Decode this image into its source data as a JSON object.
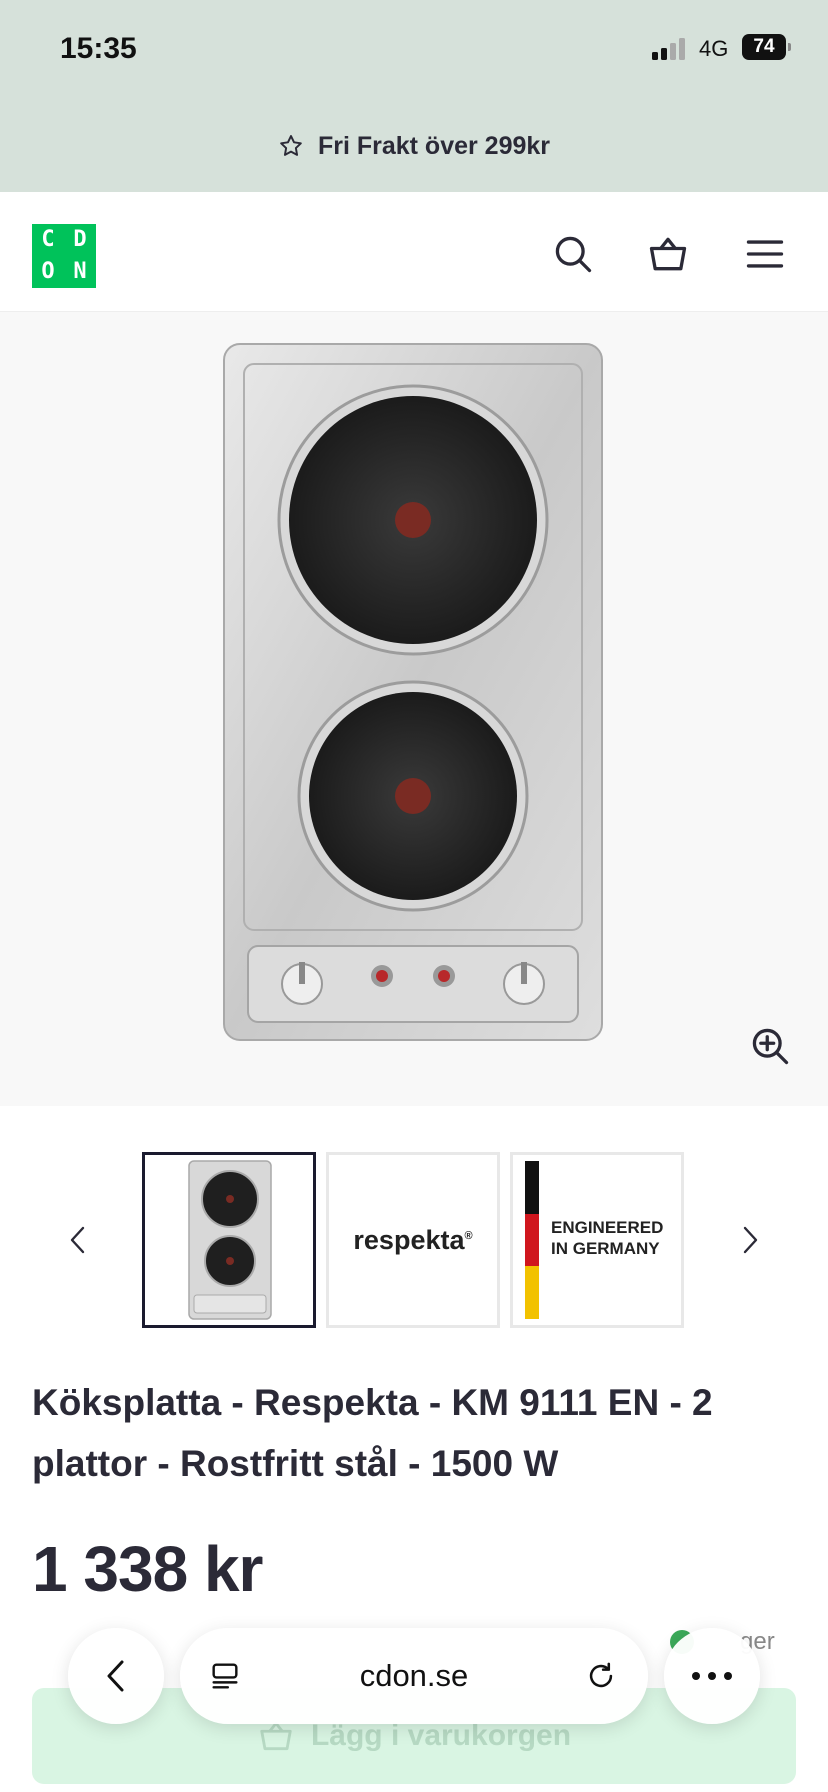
{
  "status": {
    "time": "15:35",
    "network": "4G",
    "battery": "74"
  },
  "promo": {
    "text": "Fri Frakt över 299kr",
    "icon": "star-icon"
  },
  "header": {
    "logo_letters": [
      "C",
      "D",
      "O",
      "N"
    ],
    "icons": [
      "search-icon",
      "basket-icon",
      "menu-icon"
    ]
  },
  "thumbnails": {
    "items": [
      {
        "name": "thumb-product",
        "active": true
      },
      {
        "name": "thumb-brand",
        "label": "respekta",
        "mark": "®"
      },
      {
        "name": "thumb-germany",
        "label_line1": "ENGINEERED",
        "label_line2": "IN GERMANY"
      }
    ]
  },
  "product": {
    "title": "Köksplatta - Respekta - KM 9111 EN - 2 plattor - Rostfritt stål - 1500 W",
    "price": "1 338 kr",
    "stock_text": "ger"
  },
  "cart": {
    "label": "Lägg i varukorgen"
  },
  "browser": {
    "url": "cdon.se"
  },
  "colors": {
    "brand": "#00c25a",
    "promo_bg": "#d6e1da",
    "cart_bg": "#d9f5e3",
    "text": "#2b2a37"
  }
}
